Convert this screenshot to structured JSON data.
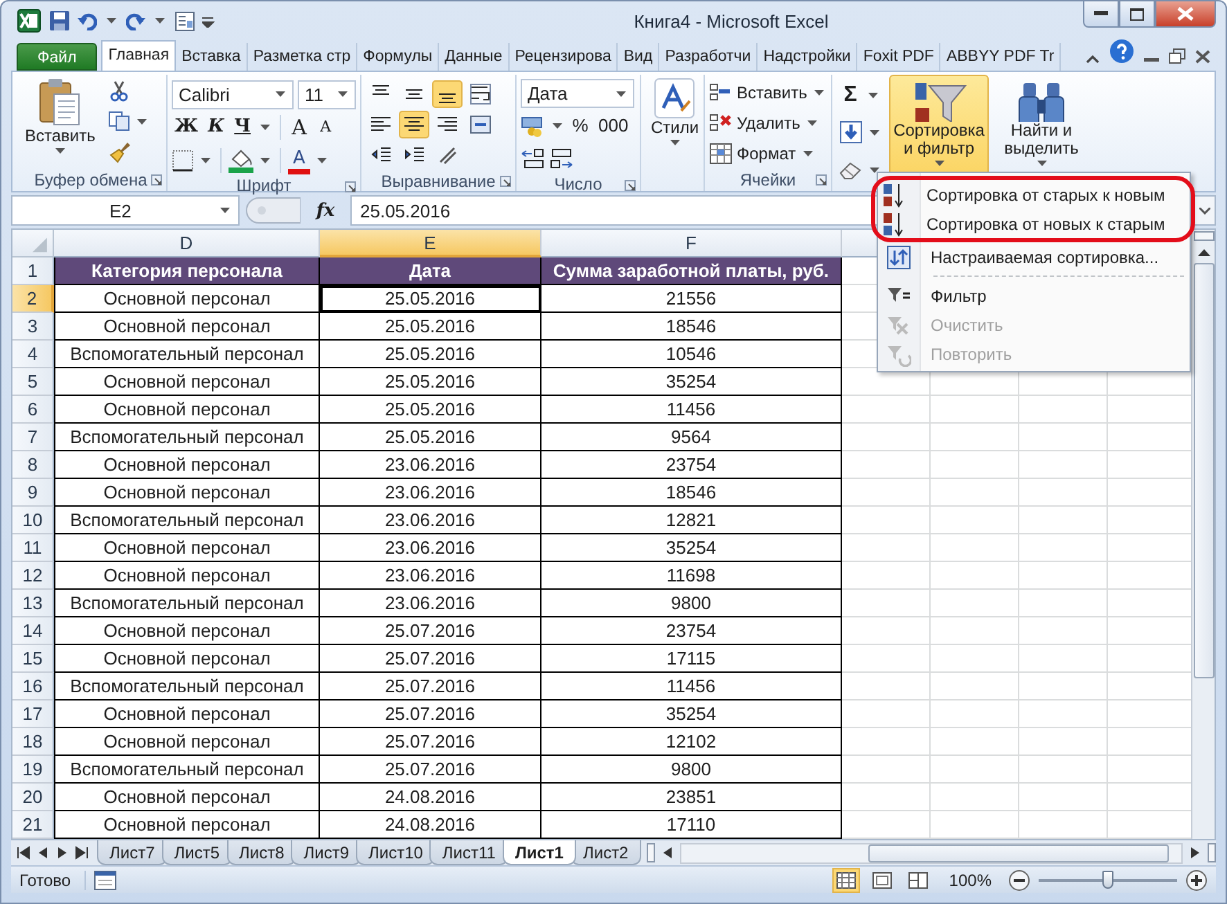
{
  "window": {
    "title": "Книга4  -  Microsoft Excel"
  },
  "ribbon_tabs": [
    {
      "label": "Файл",
      "kind": "file",
      "selected": false
    },
    {
      "label": "Главная",
      "kind": "tab",
      "selected": true
    },
    {
      "label": "Вставка",
      "kind": "tab",
      "selected": false
    },
    {
      "label": "Разметка стр",
      "kind": "tab",
      "selected": false
    },
    {
      "label": "Формулы",
      "kind": "tab",
      "selected": false
    },
    {
      "label": "Данные",
      "kind": "tab",
      "selected": false
    },
    {
      "label": "Рецензирова",
      "kind": "tab",
      "selected": false
    },
    {
      "label": "Вид",
      "kind": "tab",
      "selected": false
    },
    {
      "label": "Разработчи",
      "kind": "tab",
      "selected": false
    },
    {
      "label": "Надстройки",
      "kind": "tab",
      "selected": false
    },
    {
      "label": "Foxit PDF",
      "kind": "tab",
      "selected": false
    },
    {
      "label": "ABBYY PDF Tr",
      "kind": "tab",
      "selected": false
    }
  ],
  "clipboard": {
    "paste": "Вставить",
    "label": "Буфер обмена"
  },
  "font": {
    "family_box": "Calibri",
    "points_box": "11",
    "bold": "Ж",
    "italic": "К",
    "underline": "Ч",
    "grow": "A",
    "shrink": "A",
    "text_color_letter": "A",
    "label": "Шрифт"
  },
  "alignment": {
    "label": "Выравнивание",
    "buttons": [
      {
        "kind": "top",
        "selected": false
      },
      {
        "kind": "middle",
        "selected": false
      },
      {
        "kind": "bottom",
        "selected": true
      },
      {
        "kind": "wrap",
        "selected": false
      },
      {
        "kind": "left",
        "selected": false
      },
      {
        "kind": "center",
        "selected": true
      },
      {
        "kind": "right",
        "selected": false
      },
      {
        "kind": "merge",
        "selected": false
      },
      {
        "kind": "outdent",
        "selected": false
      },
      {
        "kind": "indent",
        "selected": false
      },
      {
        "kind": "orientation",
        "selected": false
      }
    ]
  },
  "number": {
    "format": "Дата",
    "percent": "%",
    "thousands": "000",
    "label": "Число"
  },
  "styles": {
    "label": "Стили"
  },
  "cells": {
    "items": [
      {
        "label": "Вставить",
        "kind": "insert"
      },
      {
        "label": "Удалить",
        "kind": "delete"
      },
      {
        "label": "Формат",
        "kind": "format"
      }
    ],
    "label": "Ячейки"
  },
  "editing": {
    "sum": "Σ",
    "sort": {
      "lines": [
        "Сортировка",
        "и фильтр"
      ],
      "selected": true
    },
    "find": {
      "lines": [
        "Найти и",
        "выделить"
      ],
      "selected": false
    }
  },
  "formula_bar": {
    "name_box": "E2",
    "function_label": "fx",
    "value": "25.05.2016"
  },
  "sheet": {
    "columns": [
      {
        "label": "D",
        "selected": false
      },
      {
        "label": "E",
        "selected": true
      },
      {
        "label": "F",
        "selected": false
      }
    ],
    "header": {
      "number": "1",
      "cells": [
        "Категория персонала",
        "Дата",
        "Сумма заработной платы, руб."
      ]
    },
    "rows": [
      {
        "number": "2",
        "selected": true,
        "cells": [
          "Основной персонал",
          "25.05.2016",
          "21556"
        ]
      },
      {
        "number": "3",
        "selected": false,
        "cells": [
          "Основной персонал",
          "25.05.2016",
          "18546"
        ]
      },
      {
        "number": "4",
        "selected": false,
        "cells": [
          "Вспомогательный персонал",
          "25.05.2016",
          "10546"
        ]
      },
      {
        "number": "5",
        "selected": false,
        "cells": [
          "Основной персонал",
          "25.05.2016",
          "35254"
        ]
      },
      {
        "number": "6",
        "selected": false,
        "cells": [
          "Основной персонал",
          "25.05.2016",
          "11456"
        ]
      },
      {
        "number": "7",
        "selected": false,
        "cells": [
          "Вспомогательный персонал",
          "25.05.2016",
          "9564"
        ]
      },
      {
        "number": "8",
        "selected": false,
        "cells": [
          "Основной персонал",
          "23.06.2016",
          "23754"
        ]
      },
      {
        "number": "9",
        "selected": false,
        "cells": [
          "Основной персонал",
          "23.06.2016",
          "18546"
        ]
      },
      {
        "number": "10",
        "selected": false,
        "cells": [
          "Вспомогательный персонал",
          "23.06.2016",
          "12821"
        ]
      },
      {
        "number": "11",
        "selected": false,
        "cells": [
          "Основной персонал",
          "23.06.2016",
          "35254"
        ]
      },
      {
        "number": "12",
        "selected": false,
        "cells": [
          "Основной персонал",
          "23.06.2016",
          "11698"
        ]
      },
      {
        "number": "13",
        "selected": false,
        "cells": [
          "Вспомогательный персонал",
          "23.06.2016",
          "9800"
        ]
      },
      {
        "number": "14",
        "selected": false,
        "cells": [
          "Основной персонал",
          "25.07.2016",
          "23754"
        ]
      },
      {
        "number": "15",
        "selected": false,
        "cells": [
          "Основной персонал",
          "25.07.2016",
          "17115"
        ]
      },
      {
        "number": "16",
        "selected": false,
        "cells": [
          "Вспомогательный персонал",
          "25.07.2016",
          "11456"
        ]
      },
      {
        "number": "17",
        "selected": false,
        "cells": [
          "Основной персонал",
          "25.07.2016",
          "35254"
        ]
      },
      {
        "number": "18",
        "selected": false,
        "cells": [
          "Основной персонал",
          "25.07.2016",
          "12102"
        ]
      },
      {
        "number": "19",
        "selected": false,
        "cells": [
          "Вспомогательный персонал",
          "25.07.2016",
          "9800"
        ]
      },
      {
        "number": "20",
        "selected": false,
        "cells": [
          "Основной персонал",
          "24.08.2016",
          "23851"
        ]
      },
      {
        "number": "21",
        "selected": false,
        "cells": [
          "Основной персонал",
          "24.08.2016",
          "17110"
        ]
      }
    ]
  },
  "menu": {
    "items": [
      {
        "label": "Сортировка от старых к новым",
        "kind": "sort-asc",
        "disabled": false,
        "circled": true
      },
      {
        "label": "Сортировка от новых к старым",
        "kind": "sort-desc",
        "disabled": false,
        "circled": true
      },
      {
        "label": "Настраиваемая сортировка...",
        "kind": "custom-sort",
        "disabled": false,
        "circled": false
      },
      {
        "kind": "separator"
      },
      {
        "label": "Фильтр",
        "kind": "filter",
        "disabled": false,
        "circled": false
      },
      {
        "label": "Очистить",
        "kind": "clear",
        "disabled": true,
        "circled": false
      },
      {
        "label": "Повторить",
        "kind": "reapply",
        "disabled": true,
        "circled": false
      }
    ]
  },
  "sheet_tabs": [
    {
      "label": "Лист7",
      "selected": false
    },
    {
      "label": "Лист5",
      "selected": false
    },
    {
      "label": "Лист8",
      "selected": false
    },
    {
      "label": "Лист9",
      "selected": false
    },
    {
      "label": "Лист10",
      "selected": false
    },
    {
      "label": "Лист11",
      "selected": false
    },
    {
      "label": "Лист1",
      "selected": true
    },
    {
      "label": "Лист2",
      "selected": false
    }
  ],
  "status_bar": {
    "status": "Готово",
    "views": [
      {
        "kind": "normal",
        "selected": true
      },
      {
        "kind": "page-layout",
        "selected": false
      },
      {
        "kind": "page-break",
        "selected": false
      }
    ],
    "zoom": "100%",
    "zoom_slider": {
      "level": 0.5
    }
  }
}
